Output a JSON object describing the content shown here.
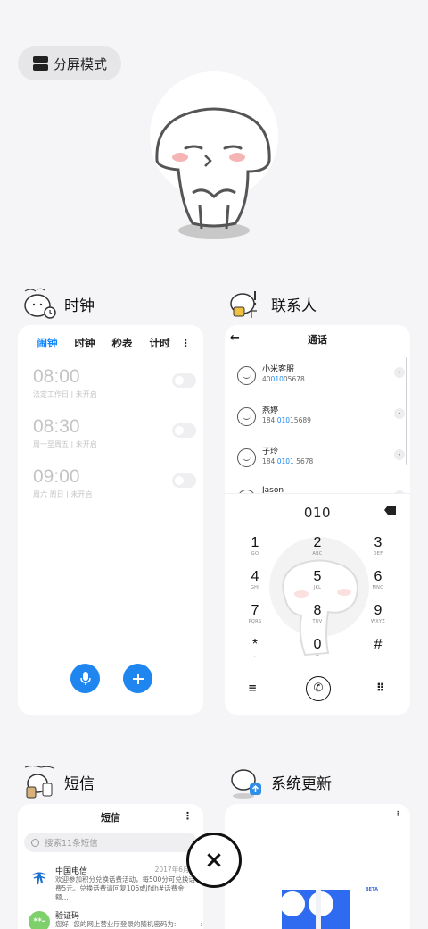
{
  "split_mode": {
    "label": "分屏模式",
    "icon": "split-screen-icon"
  },
  "clock": {
    "title": "时钟",
    "tabs": [
      {
        "label": "闹钟",
        "active": true
      },
      {
        "label": "时钟",
        "active": false
      },
      {
        "label": "秒表",
        "active": false
      },
      {
        "label": "计时",
        "active": false
      }
    ],
    "more": "⋮",
    "alarms": [
      {
        "time": "08:00",
        "desc": "法定工作日 | 未开启"
      },
      {
        "time": "08:30",
        "desc": "周一至周五 | 未开启"
      },
      {
        "time": "09:00",
        "desc": "周六 周日 | 未开启"
      }
    ],
    "accent": "#0d84ff"
  },
  "contacts": {
    "title": "联系人",
    "header": "通话",
    "back": "←",
    "list": [
      {
        "name": "小米客服",
        "pre": "40",
        "hl": "010",
        "post": "05678"
      },
      {
        "name": "燕婷",
        "pre": "184 ",
        "hl": "010",
        "post": "15689"
      },
      {
        "name": "子玲",
        "pre": "184 ",
        "hl": "0101",
        "post": " 5678"
      },
      {
        "name": "Jason",
        "pre": "",
        "hl": "",
        "post": ""
      }
    ],
    "arrow": "›",
    "dial_number": "010",
    "keys": [
      {
        "d": "1",
        "l": "GO"
      },
      {
        "d": "2",
        "l": "ABC"
      },
      {
        "d": "3",
        "l": "DEF"
      },
      {
        "d": "4",
        "l": "GHI"
      },
      {
        "d": "5",
        "l": "JKL"
      },
      {
        "d": "6",
        "l": "MNO"
      },
      {
        "d": "7",
        "l": "PQRS"
      },
      {
        "d": "8",
        "l": "TUV"
      },
      {
        "d": "9",
        "l": "WXYZ"
      },
      {
        "d": "*",
        "l": ","
      },
      {
        "d": "0",
        "l": "+"
      },
      {
        "d": "#",
        "l": ""
      }
    ],
    "menu": "≡",
    "grid": "⠿",
    "call": "✆"
  },
  "sms": {
    "title": "短信",
    "header": "短信",
    "more": "⋮",
    "search_placeholder": "搜索11条短信",
    "items": [
      {
        "name": "中国电信",
        "date": "2017年6月30",
        "text": "欢迎参加积分兑换话费活动，每500分可兑换话费5元。兑换话费请回复106或jfdh#话费金额...",
        "icon_color": "#1b6fd1"
      },
      {
        "name": "验证码",
        "date": "",
        "text": "您好! 您的网上营业厅登录的随机密码为:",
        "icon_color": "#7dd06a"
      }
    ],
    "chev": "›"
  },
  "update": {
    "title": "系统更新",
    "dots": "⁝",
    "beta": "BETA",
    "accent": "#2f6bf0"
  },
  "close": {
    "label": "×"
  }
}
